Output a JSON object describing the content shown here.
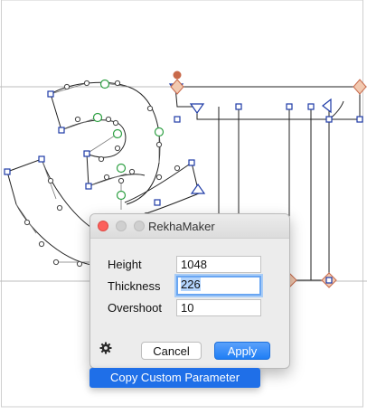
{
  "dialog": {
    "title": "RekhaMaker",
    "fields": [
      {
        "label": "Height",
        "value": "1048"
      },
      {
        "label": "Thickness",
        "value": "226"
      },
      {
        "label": "Overshoot",
        "value": "10"
      }
    ],
    "cancel_label": "Cancel",
    "apply_label": "Apply"
  },
  "context_menu": {
    "item_label": "Copy Custom Parameter"
  },
  "colors": {
    "accent": "#1f6fe8",
    "node_blue": "#1d3aa6",
    "smooth_node_green": "#2ea043",
    "anchor": "#c8694a",
    "close_red": "#fc605c"
  }
}
